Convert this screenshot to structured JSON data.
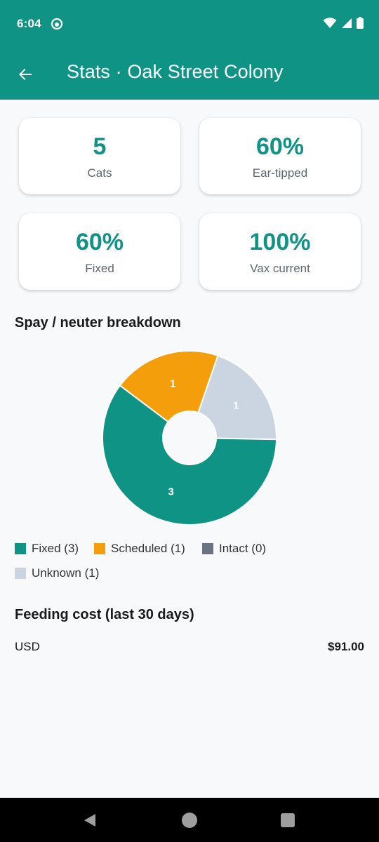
{
  "status_bar": {
    "time": "6:04"
  },
  "app_bar": {
    "title": "Stats · Oak Street Colony"
  },
  "stats": [
    {
      "value": "5",
      "label": "Cats"
    },
    {
      "value": "60%",
      "label": "Ear-tipped"
    },
    {
      "value": "60%",
      "label": "Fixed"
    },
    {
      "value": "100%",
      "label": "Vax current"
    }
  ],
  "spay_section": {
    "title": "Spay / neuter breakdown"
  },
  "chart_data": {
    "type": "pie",
    "donut": true,
    "slices": [
      {
        "label": "Fixed",
        "value": 3,
        "color": "#0E9384"
      },
      {
        "label": "Scheduled",
        "value": 1,
        "color": "#F59E0B"
      },
      {
        "label": "Intact",
        "value": 0,
        "color": "#6B7280"
      },
      {
        "label": "Unknown",
        "value": 1,
        "color": "#CBD5E1"
      }
    ],
    "legend": [
      {
        "text": "Fixed (3)",
        "color": "#0E9384"
      },
      {
        "text": "Scheduled (1)",
        "color": "#F59E0B"
      },
      {
        "text": "Intact (0)",
        "color": "#6B7280"
      },
      {
        "text": "Unknown (1)",
        "color": "#CBD5E1"
      }
    ],
    "legend_position": "bottom"
  },
  "feeding": {
    "title": "Feeding cost (last 30 days)",
    "currency": "USD",
    "amount": "$91.00"
  },
  "colors": {
    "primary": "#0E9384"
  }
}
